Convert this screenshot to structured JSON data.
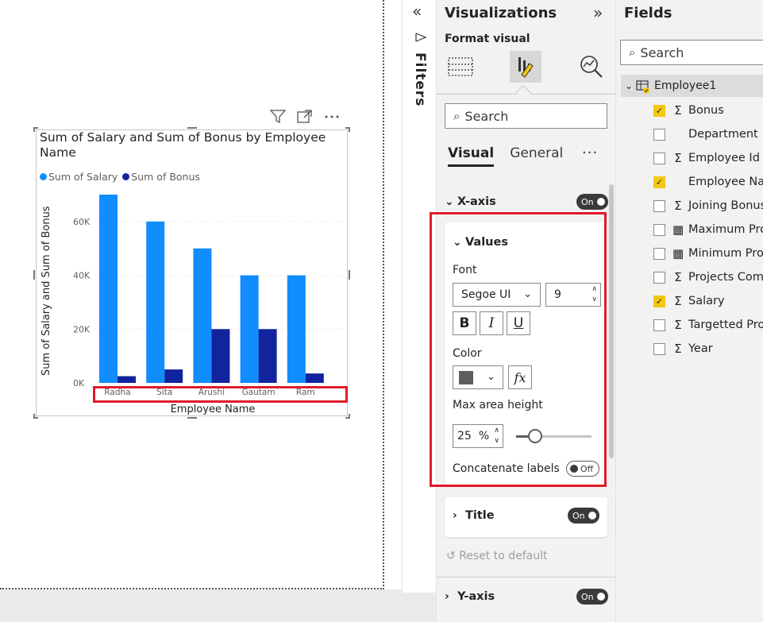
{
  "visual": {
    "title": "Sum of Salary and Sum of Bonus by Employee Name",
    "legend": [
      {
        "label": "Sum of Salary",
        "color": "#118dff"
      },
      {
        "label": "Sum of Bonus",
        "color": "#12239e"
      }
    ]
  },
  "chart_data": {
    "type": "bar",
    "title": "Sum of Salary and Sum of Bonus by Employee Name",
    "xlabel": "Employee Name",
    "ylabel": "Sum of Salary and Sum of Bonus",
    "categories": [
      "Radha",
      "Sita",
      "Arushi",
      "Gautam",
      "Ram"
    ],
    "series": [
      {
        "name": "Sum of Salary",
        "color": "#118dff",
        "values": [
          70000,
          60000,
          50000,
          40000,
          40000
        ]
      },
      {
        "name": "Sum of Bonus",
        "color": "#12239e",
        "values": [
          2500,
          5000,
          20000,
          20000,
          3500
        ]
      }
    ],
    "ylim": [
      0,
      70000
    ],
    "yticks": [
      "0K",
      "20K",
      "40K",
      "60K"
    ],
    "ytick_values": [
      0,
      20000,
      40000,
      60000
    ],
    "grid": true,
    "legend_position": "top-left"
  },
  "filters": {
    "label": "Filters"
  },
  "viz": {
    "title": "Visualizations",
    "format_visual": "Format visual",
    "search_placeholder": "Search",
    "tab_visual": "Visual",
    "tab_general": "General",
    "xaxis_label": "X-axis",
    "xaxis_toggle": "On",
    "values_label": "Values",
    "font_label": "Font",
    "font_family": "Segoe UI",
    "font_size": "9",
    "bold": "B",
    "italic": "I",
    "underline": "U",
    "color_label": "Color",
    "color_value": "#605e5c",
    "fx": "fx",
    "max_area_label": "Max area height",
    "max_area_value": "25",
    "max_area_unit": "%",
    "max_area_fraction": 0.25,
    "concat_label": "Concatenate labels",
    "concat_toggle": "Off",
    "title_section": "Title",
    "title_toggle": "On",
    "reset": "Reset to default",
    "yaxis_label": "Y-axis",
    "yaxis_toggle": "On"
  },
  "fields": {
    "title": "Fields",
    "search_placeholder": "Search",
    "table": "Employee1",
    "items": [
      {
        "label": "Bonus",
        "icon": "sigma",
        "checked": true
      },
      {
        "label": "Department",
        "icon": "none",
        "checked": false
      },
      {
        "label": "Employee Id",
        "icon": "sigma",
        "checked": false
      },
      {
        "label": "Employee Nar",
        "icon": "none",
        "checked": true
      },
      {
        "label": "Joining Bonus",
        "icon": "sigma",
        "checked": false
      },
      {
        "label": "Maximum Pro",
        "icon": "calculator",
        "checked": false
      },
      {
        "label": "Minimum Proj",
        "icon": "calculator",
        "checked": false
      },
      {
        "label": "Projects Comp",
        "icon": "sigma",
        "checked": false
      },
      {
        "label": "Salary",
        "icon": "sigma",
        "checked": true
      },
      {
        "label": "Targetted Proj",
        "icon": "sigma",
        "checked": false
      },
      {
        "label": "Year",
        "icon": "sigma",
        "checked": false
      }
    ]
  }
}
